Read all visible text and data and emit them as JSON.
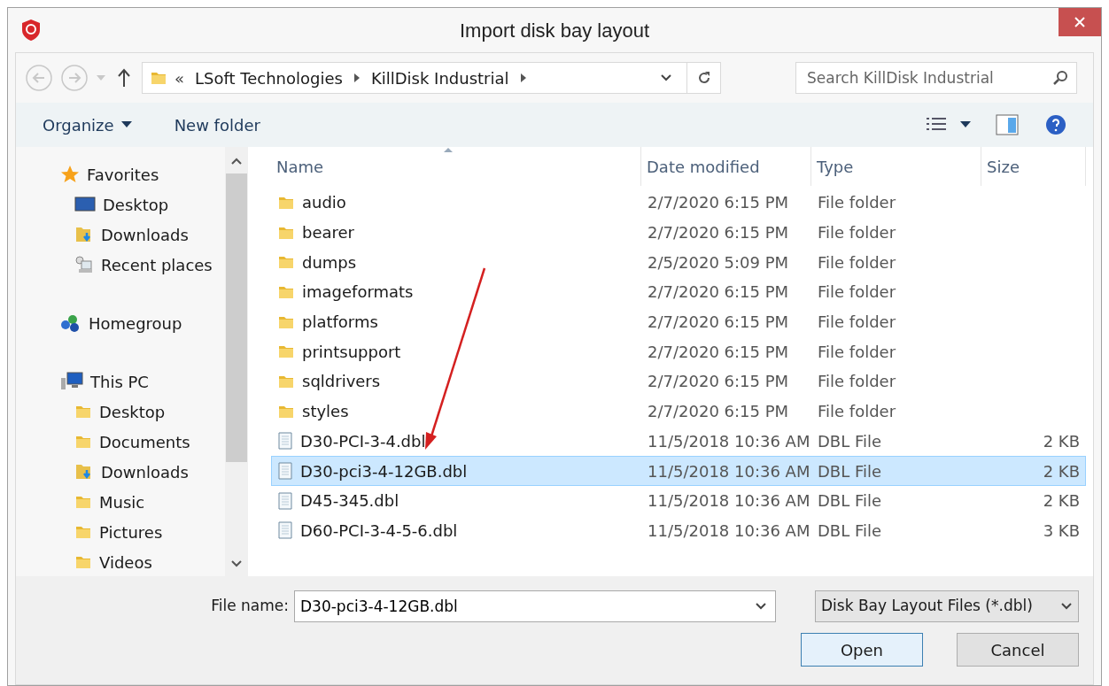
{
  "window": {
    "title": "Import disk bay layout"
  },
  "address": {
    "overflow": "«",
    "crumbs": [
      "LSoft Technologies",
      "KillDisk Industrial"
    ]
  },
  "search": {
    "placeholder": "Search KillDisk Industrial"
  },
  "command_bar": {
    "organize": "Organize",
    "new_folder": "New folder"
  },
  "nav": [
    {
      "label": "Favorites",
      "kind": "star",
      "children": [
        {
          "label": "Desktop",
          "kind": "desktop"
        },
        {
          "label": "Downloads",
          "kind": "downloads"
        },
        {
          "label": "Recent places",
          "kind": "recent"
        }
      ]
    },
    {
      "label": "Homegroup",
      "kind": "homegroup"
    },
    {
      "label": "This PC",
      "kind": "pc",
      "children": [
        {
          "label": "Desktop",
          "kind": "folder"
        },
        {
          "label": "Documents",
          "kind": "folder"
        },
        {
          "label": "Downloads",
          "kind": "downloads"
        },
        {
          "label": "Music",
          "kind": "folder"
        },
        {
          "label": "Pictures",
          "kind": "folder"
        },
        {
          "label": "Videos",
          "kind": "folder"
        }
      ]
    }
  ],
  "table": {
    "columns": [
      "Name",
      "Date modified",
      "Type",
      "Size"
    ],
    "rows": [
      {
        "kind": "folder",
        "name": "audio",
        "date": "2/7/2020 6:15 PM",
        "type": "File folder",
        "selected": false
      },
      {
        "kind": "folder",
        "name": "bearer",
        "date": "2/7/2020 6:15 PM",
        "type": "File folder",
        "selected": false
      },
      {
        "kind": "folder",
        "name": "dumps",
        "date": "2/5/2020 5:09 PM",
        "type": "File folder",
        "selected": false
      },
      {
        "kind": "folder",
        "name": "imageformats",
        "date": "2/7/2020 6:15 PM",
        "type": "File folder",
        "selected": false
      },
      {
        "kind": "folder",
        "name": "platforms",
        "date": "2/7/2020 6:15 PM",
        "type": "File folder",
        "selected": false
      },
      {
        "kind": "folder",
        "name": "printsupport",
        "date": "2/7/2020 6:15 PM",
        "type": "File folder",
        "selected": false
      },
      {
        "kind": "folder",
        "name": "sqldrivers",
        "date": "2/7/2020 6:15 PM",
        "type": "File folder",
        "selected": false
      },
      {
        "kind": "folder",
        "name": "styles",
        "date": "2/7/2020 6:15 PM",
        "type": "File folder",
        "selected": false
      },
      {
        "kind": "file",
        "name": "D30-PCI-3-4.dbl",
        "date": "11/5/2018 10:36 AM",
        "type": "DBL File",
        "size": "2 KB",
        "selected": false
      },
      {
        "kind": "file",
        "name": "D30-pci3-4-12GB.dbl",
        "date": "11/5/2018 10:36 AM",
        "type": "DBL File",
        "size": "2 KB",
        "selected": true
      },
      {
        "kind": "file",
        "name": "D45-345.dbl",
        "date": "11/5/2018 10:36 AM",
        "type": "DBL File",
        "size": "2 KB",
        "selected": false
      },
      {
        "kind": "file",
        "name": "D60-PCI-3-4-5-6.dbl",
        "date": "11/5/2018 10:36 AM",
        "type": "DBL File",
        "size": "3 KB",
        "selected": false
      }
    ]
  },
  "file_name": {
    "label": "File name:",
    "value": "D30-pci3-4-12GB.dbl"
  },
  "file_type": {
    "value": "Disk Bay Layout Files (*.dbl)"
  },
  "buttons": {
    "open": "Open",
    "cancel": "Cancel"
  }
}
